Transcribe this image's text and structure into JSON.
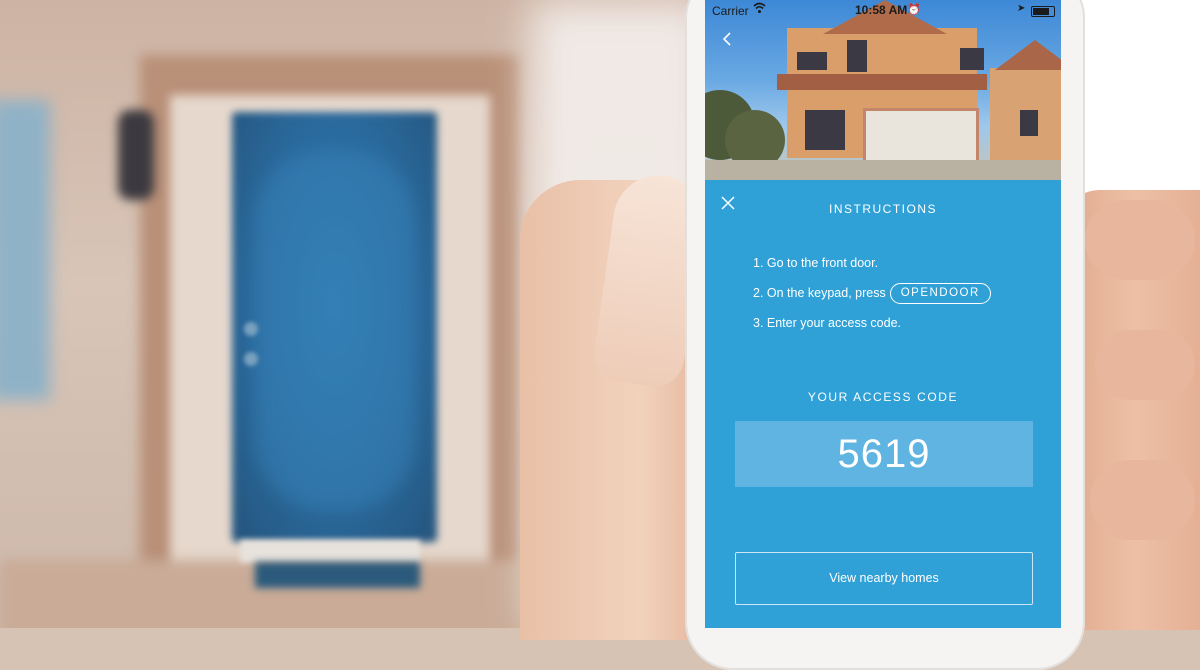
{
  "status_bar": {
    "carrier": "Carrier",
    "time": "10:58 AM"
  },
  "instructions": {
    "title": "INSTRUCTIONS",
    "steps": [
      "1. Go to the front door.",
      "2. On the keypad, press",
      "3. Enter your access code."
    ],
    "keypad_button_label": "OPENDOOR"
  },
  "access_code": {
    "label": "YOUR ACCESS CODE",
    "value": "5619"
  },
  "actions": {
    "nearby_label": "View nearby homes"
  },
  "colors": {
    "accent": "#2fa1d7",
    "code_box": "#5fb4e1",
    "door": "#2a6a9d"
  },
  "icons": {
    "back": "chevron-left-icon",
    "close": "close-icon",
    "wifi": "wifi-icon",
    "location": "location-arrow-icon",
    "battery": "battery-icon"
  }
}
